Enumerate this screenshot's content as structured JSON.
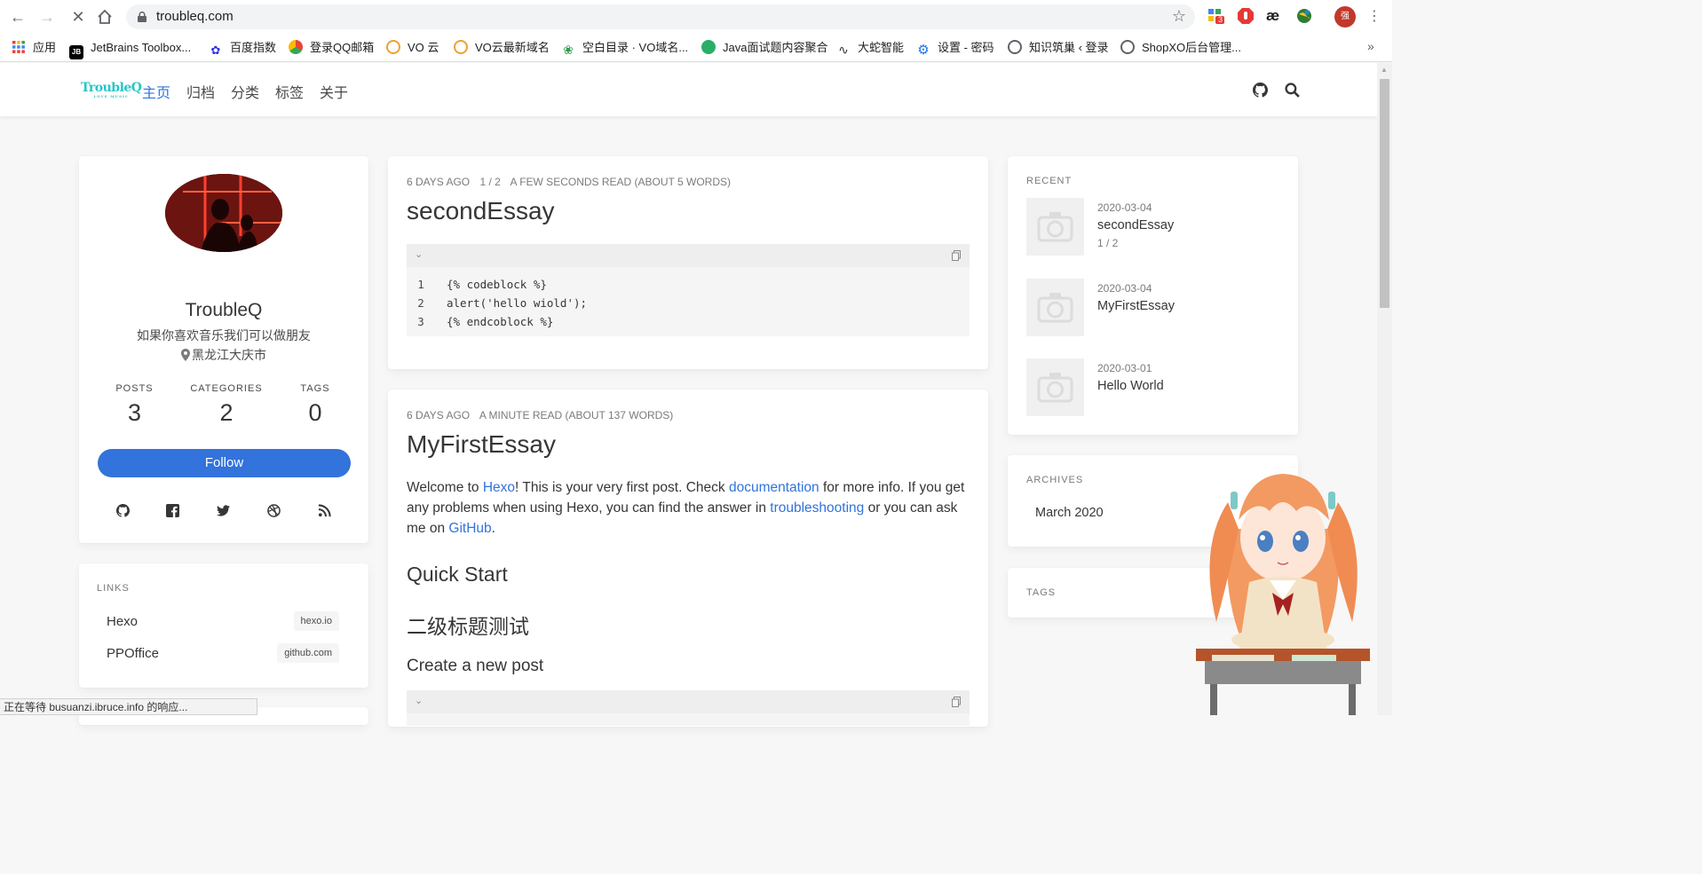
{
  "browser": {
    "url": "troubleq.com",
    "extension_badge": "3",
    "profile_initial": "强",
    "bookmarks": [
      "应用",
      "JetBrains Toolbox...",
      "百度指数",
      "登录QQ邮箱",
      "VO 云",
      "VO云最新域名",
      "空白目录 · VO域名...",
      "Java面试题内容聚合",
      "大蛇智能",
      "设置 - 密码",
      "知识筑巢 ‹ 登录",
      "ShopXO后台管理..."
    ],
    "status_text": "正在等待 busuanzi.ibruce.info 的响应..."
  },
  "site": {
    "logo": "TroubleQ",
    "logo_sub": "LOVE MUSIC",
    "nav": [
      "主页",
      "归档",
      "分类",
      "标签",
      "关于"
    ],
    "active_nav": "主页"
  },
  "profile": {
    "name": "TroubleQ",
    "bio": "如果你喜欢音乐我们可以做朋友",
    "location": "黑龙江大庆市",
    "stats": [
      {
        "label": "POSTS",
        "value": "3"
      },
      {
        "label": "CATEGORIES",
        "value": "2"
      },
      {
        "label": "TAGS",
        "value": "0"
      }
    ],
    "follow_label": "Follow"
  },
  "links": {
    "heading": "LINKS",
    "items": [
      {
        "name": "Hexo",
        "domain": "hexo.io"
      },
      {
        "name": "PPOffice",
        "domain": "github.com"
      }
    ]
  },
  "posts": [
    {
      "date": "6 DAYS AGO",
      "category": "1 / 2",
      "read": "A FEW SECONDS READ (ABOUT 5 WORDS)",
      "title": "secondEssay",
      "code": [
        "{% codeblock %}",
        "alert('hello wiold');",
        "{% endcoblock %}"
      ]
    },
    {
      "date": "6 DAYS AGO",
      "read": "A MINUTE READ (ABOUT 137 WORDS)",
      "title": "MyFirstEssay",
      "p_text_1": "Welcome to ",
      "p_link_1": "Hexo",
      "p_text_2": "! This is your very first post. Check ",
      "p_link_2": "documentation",
      "p_text_3": " for more info. If you get any problems when using Hexo, you can find the answer in ",
      "p_link_3": "troubleshooting",
      "p_text_4": " or you can ask me on ",
      "p_link_4": "GitHub",
      "p_text_5": ".",
      "h2_1": "Quick Start",
      "h2_2": "二级标题测试",
      "h3_1": "Create a new post"
    }
  ],
  "recent": {
    "heading": "RECENT",
    "items": [
      {
        "date": "2020-03-04",
        "title": "secondEssay",
        "category": "1 / 2"
      },
      {
        "date": "2020-03-04",
        "title": "MyFirstEssay",
        "category": ""
      },
      {
        "date": "2020-03-01",
        "title": "Hello World",
        "category": ""
      }
    ]
  },
  "archives": {
    "heading": "ARCHIVES",
    "items": [
      "March 2020"
    ]
  },
  "tags_widget": {
    "heading": "TAGS"
  },
  "colors": {
    "accent": "#3273dc",
    "logo": "#26c6c6"
  }
}
